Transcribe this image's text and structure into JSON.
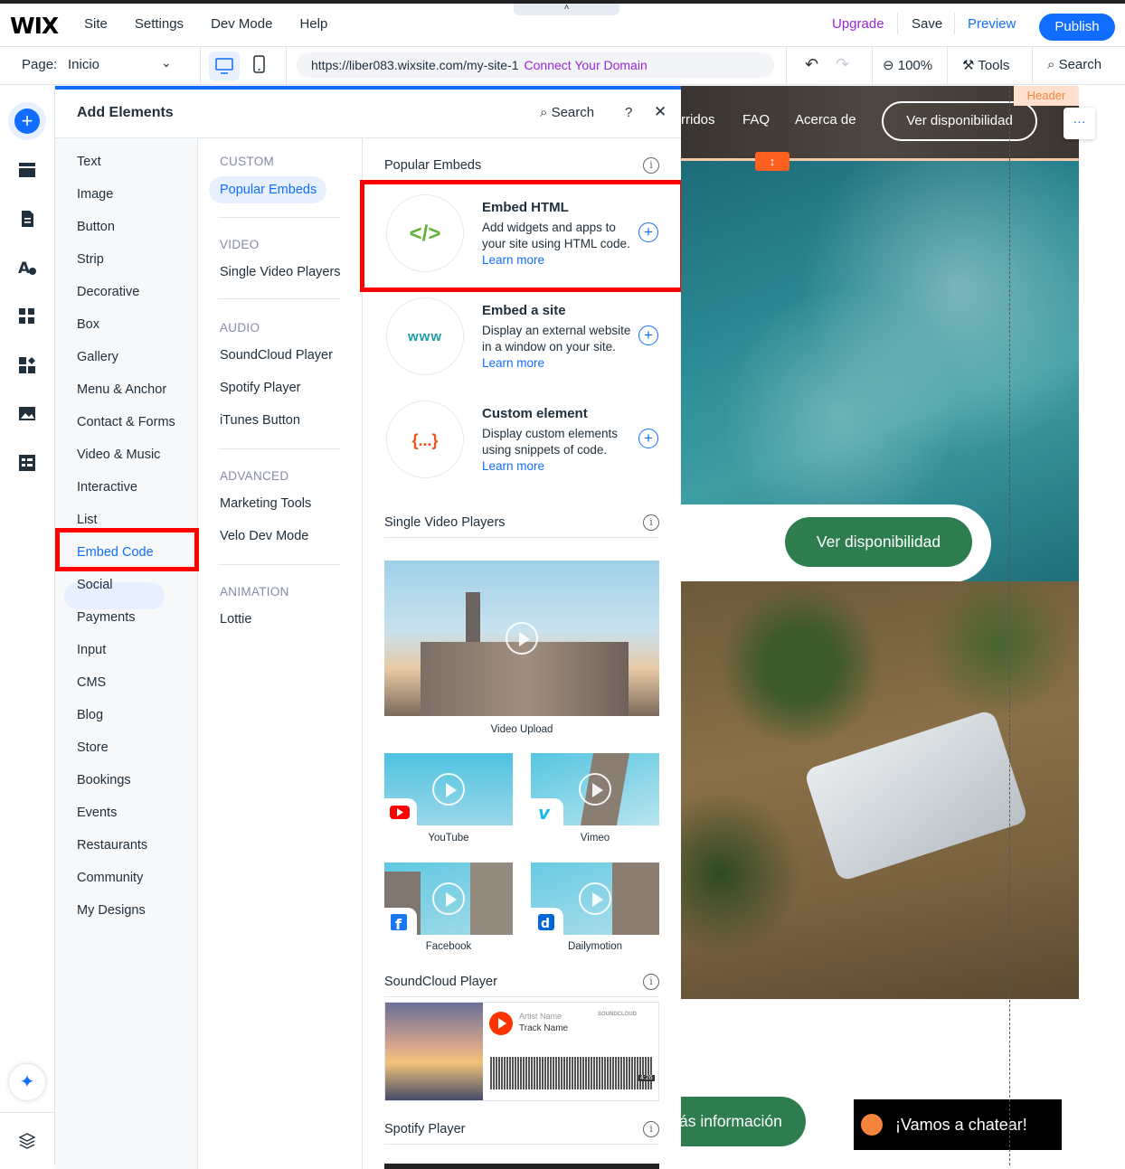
{
  "topbar": {
    "logo": "WIX",
    "menu": [
      "Site",
      "Settings",
      "Dev Mode",
      "Help"
    ],
    "collapse": "˄",
    "upgrade": "Upgrade",
    "save": "Save",
    "preview": "Preview",
    "publish": "Publish"
  },
  "toolbar": {
    "page_label": "Page:",
    "page_name": "Inicio",
    "url": "https://liber083.wixsite.com/my-site-1",
    "connect": "Connect Your Domain",
    "zoom": "100%",
    "tools": "Tools",
    "search": "Search"
  },
  "panel": {
    "title": "Add Elements",
    "search": "Search",
    "help": "?",
    "close": "✕",
    "categories": [
      "Text",
      "Image",
      "Button",
      "Strip",
      "Decorative",
      "Box",
      "Gallery",
      "Menu & Anchor",
      "Contact & Forms",
      "Video & Music",
      "Interactive",
      "List",
      "Embed Code",
      "Social",
      "Payments",
      "Input",
      "CMS",
      "Blog",
      "Store",
      "Bookings",
      "Events",
      "Restaurants",
      "Community",
      "My Designs"
    ],
    "selected_category": "Embed Code",
    "sub": {
      "custom_head": "CUSTOM",
      "custom_sel": "Popular Embeds",
      "video_head": "VIDEO",
      "video_items": [
        "Single Video Players"
      ],
      "audio_head": "AUDIO",
      "audio_items": [
        "SoundCloud Player",
        "Spotify Player",
        "iTunes Button"
      ],
      "advanced_head": "ADVANCED",
      "advanced_items": [
        "Marketing Tools",
        "Velo Dev Mode"
      ],
      "animation_head": "ANIMATION",
      "animation_items": [
        "Lottie"
      ]
    },
    "main": {
      "popular_title": "Popular Embeds",
      "embeds": [
        {
          "glyph": "</>",
          "title": "Embed HTML",
          "desc": "Add widgets and apps to your site using HTML code.",
          "link": "Learn more",
          "color": "#5fb336"
        },
        {
          "glyph": "www",
          "title": "Embed a site",
          "desc": "Display an external website in a window on your site.",
          "link": "Learn more",
          "color": "#1a9fa6"
        },
        {
          "glyph": "{...}",
          "title": "Custom element",
          "desc": "Display custom elements using snippets of code.",
          "link": "Learn more",
          "color": "#f0541e"
        }
      ],
      "svp_title": "Single Video Players",
      "video_upload": "Video Upload",
      "videos": [
        "YouTube",
        "Vimeo",
        "Facebook",
        "Dailymotion"
      ],
      "soundcloud_title": "SoundCloud Player",
      "sc_artist": "Artist Name",
      "sc_track": "Track Name",
      "sc_brand": "SOUNDCLOUD",
      "sc_time": "4:26",
      "spotify_title": "Spotify Player",
      "info": "i"
    }
  },
  "canvas": {
    "header_tag": "Header",
    "nav": [
      "rridos",
      "FAQ",
      "Acerca de"
    ],
    "header_btn": "Ver disponibilidad",
    "dots": "···",
    "handle": "↕",
    "ver_btn": "Ver disponibilidad",
    "mas_btn": "ás información",
    "chat": "¡Vamos a chatear!"
  },
  "colors": {
    "accent": "#116dff",
    "upgrade": "#9a27d5",
    "highlight": "#ff0000",
    "site_green": "#2e7d4f"
  }
}
